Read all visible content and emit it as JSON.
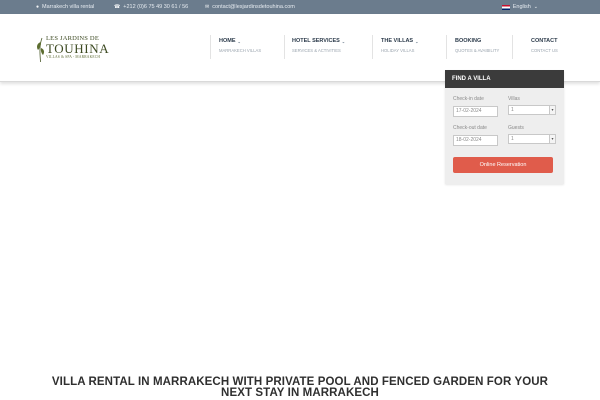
{
  "topbar": {
    "location": "Marrakech villa rental",
    "phone": "+212 (0)6 75 49 30 61 / 56",
    "email": "contact@lesjardinsdetouhina.com",
    "language": "English"
  },
  "logo": {
    "line1": "LES JARDINS DE",
    "line2": "TOUHINA",
    "line3": "VILLAS & SPA - MARRAKECH"
  },
  "nav": [
    {
      "title": "HOME",
      "sub": "MARRAKECH VILLAS",
      "has_dropdown": true
    },
    {
      "title": "HOTEL SERVICES",
      "sub": "SERVICES & ACTIVITIES",
      "has_dropdown": true
    },
    {
      "title": "THE VILLAS",
      "sub": "HOLIDAY VILLAS",
      "has_dropdown": true
    },
    {
      "title": "BOOKING",
      "sub": "QUOTES & AVAIBILITY",
      "has_dropdown": false
    },
    {
      "title": "CONTACT",
      "sub": "CONTACT US",
      "has_dropdown": false
    }
  ],
  "widget": {
    "title": "FIND A VILLA",
    "checkin_label": "Check-in date",
    "checkin_value": "17-02-2024",
    "villas_label": "Villas",
    "villas_value": "1",
    "checkout_label": "Check-out date",
    "checkout_value": "18-02-2024",
    "guests_label": "Guests",
    "guests_value": "1",
    "button": "Online Reservation"
  },
  "headline": {
    "line1": "VILLA RENTAL IN MARRAKECH WITH PRIVATE POOL AND FENCED GARDEN FOR YOUR",
    "line2": "NEXT STAY IN MARRAKECH"
  },
  "colors": {
    "topbar": "#6b7c8d",
    "widget_header": "#3b3b3b",
    "reservation_button": "#e05c4b",
    "logo_green": "#3d4a22"
  }
}
